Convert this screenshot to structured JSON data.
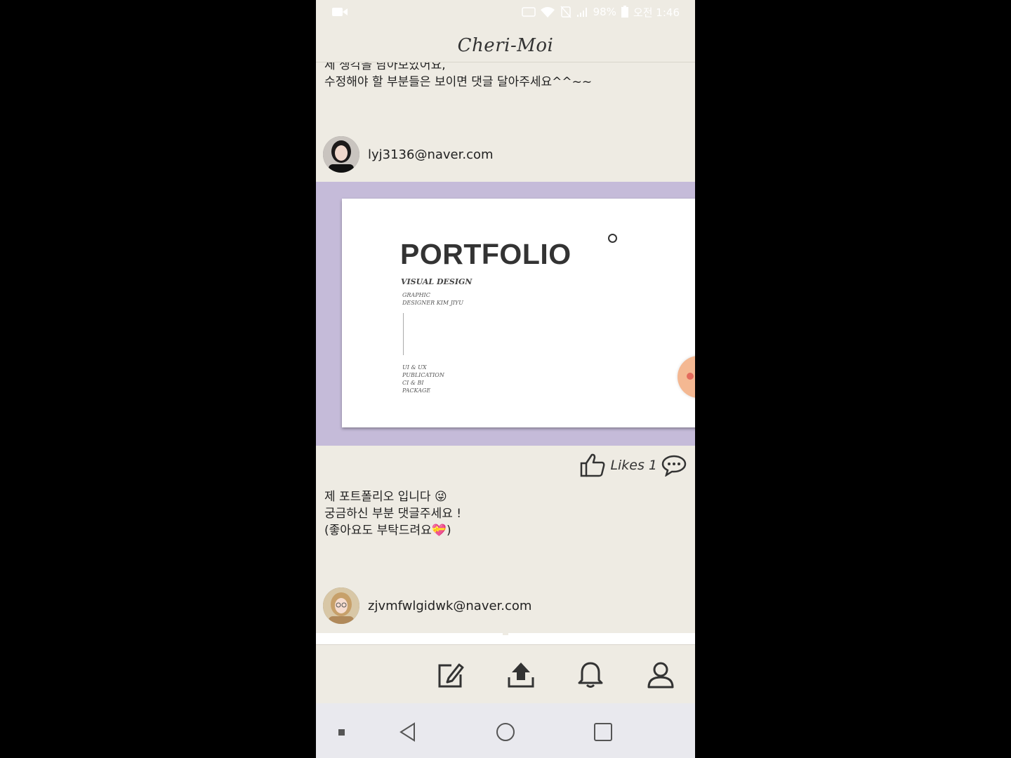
{
  "status_bar": {
    "battery": "98%",
    "time": "오전 1:46",
    "icons": [
      "video-recording-icon",
      "nfc-icon",
      "wifi-icon",
      "mute-icon",
      "signal-icon",
      "battery-icon"
    ]
  },
  "app": {
    "title": "Cheri-Moi"
  },
  "feed": {
    "posts": [
      {
        "text": "제 생각을 남아보았어요,\n수정해야 할 부분들은 보이면 댓글 달아주세요^^~~",
        "author": "lyj3136@naver.com",
        "image": {
          "title": "PORTFOLIO",
          "subtitle": "VISUAL DESIGN",
          "tagline_1": "GRAPHIC",
          "tagline_2": "DESIGNER KIM JIYU",
          "categories": [
            "UI & UX",
            "PUBLICATION",
            "CI & BI",
            "PACKAGE"
          ]
        },
        "likes_label": "Likes",
        "likes_count": "1"
      },
      {
        "text": "제 포트폴리오 입니다 😜\n궁금하신 부분 댓글주세요 !\n(좋아요도 부탁드려요💝)",
        "author": "zjvmfwlgidwk@naver.com"
      }
    ]
  },
  "bottom_nav": {
    "items": [
      "write-icon",
      "upload-icon",
      "bell-icon",
      "profile-icon"
    ]
  },
  "android_nav": {
    "items": [
      "back-icon",
      "home-icon",
      "recents-icon"
    ]
  },
  "colors": {
    "background": "#eeebe3",
    "image_bg": "#c5bbd9",
    "accent": "#f4b892"
  }
}
